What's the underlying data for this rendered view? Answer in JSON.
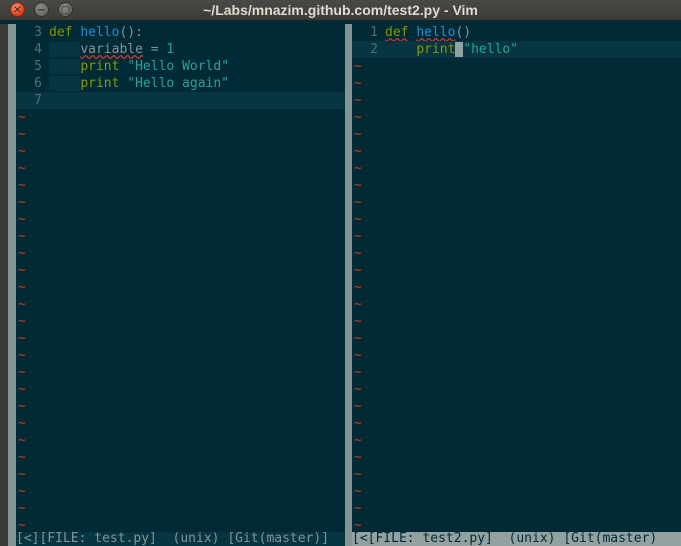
{
  "window": {
    "title": "~/Labs/mnazim.github.com/test2.py - Vim",
    "close_glyph": "✕",
    "min_glyph": "−",
    "max_glyph": "□"
  },
  "left_pane": {
    "lines": [
      {
        "num": "3",
        "parts": [
          {
            "t": "def",
            "c": "kw"
          },
          {
            "t": " ",
            "c": "code"
          },
          {
            "t": "hello",
            "c": "fn"
          },
          {
            "t": "():",
            "c": "code"
          }
        ]
      },
      {
        "num": "4",
        "parts": [
          {
            "t": "    ",
            "c": "indent"
          },
          {
            "t": "variable",
            "c": "code spell"
          },
          {
            "t": " = ",
            "c": "code"
          },
          {
            "t": "1",
            "c": "num"
          }
        ]
      },
      {
        "num": "5",
        "parts": [
          {
            "t": "    ",
            "c": "indent"
          },
          {
            "t": "print",
            "c": "kw"
          },
          {
            "t": " ",
            "c": "code"
          },
          {
            "t": "\"Hello World\"",
            "c": "str"
          }
        ]
      },
      {
        "num": "6",
        "parts": [
          {
            "t": "    ",
            "c": "indent"
          },
          {
            "t": "print",
            "c": "kw"
          },
          {
            "t": " ",
            "c": "code"
          },
          {
            "t": "\"Hello again\"",
            "c": "str"
          }
        ]
      },
      {
        "num": "7",
        "parts": [],
        "cursorline": true
      }
    ],
    "tilde_count": 25,
    "status": "[<][FILE: test.py]  (unix) [Git(master)]"
  },
  "right_pane": {
    "lines": [
      {
        "num": "1",
        "parts": [
          {
            "t": "def",
            "c": "kw spell"
          },
          {
            "t": " ",
            "c": "code"
          },
          {
            "t": "hello",
            "c": "fn spell"
          },
          {
            "t": "()",
            "c": "code"
          }
        ]
      },
      {
        "num": "2",
        "parts": [
          {
            "t": "    ",
            "c": "indent"
          },
          {
            "t": "print",
            "c": "kw"
          },
          {
            "t": " ",
            "c": "cursor"
          },
          {
            "t": "\"hello\"",
            "c": "str"
          }
        ],
        "cursorline": true
      }
    ],
    "tilde_count": 28,
    "status": "[<[FILE: test2.py]  (unix) [Git(master)"
  },
  "colors": {
    "background": "#002b36",
    "cursorline": "#073642",
    "keyword": "#859900",
    "function": "#268bd2",
    "string": "#2aa198",
    "tilde": "#dc322f",
    "line_number": "#586e75"
  }
}
